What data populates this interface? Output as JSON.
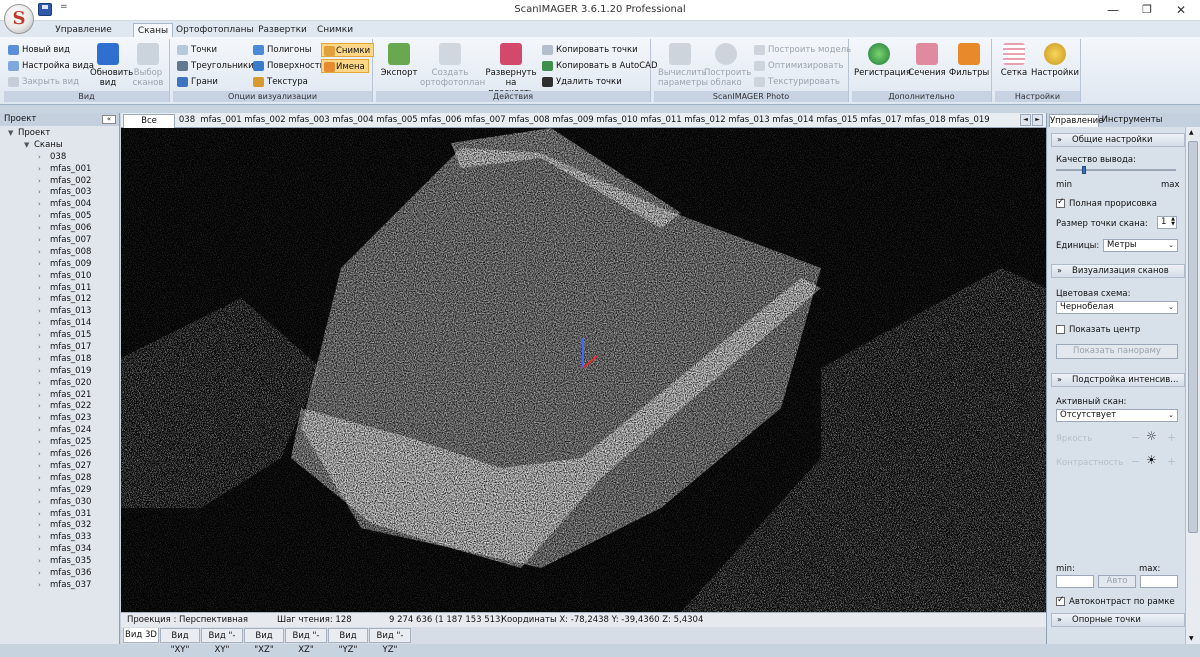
{
  "window": {
    "title": "ScanIMAGER 3.6.1.20 Professional",
    "controls": {
      "minimize": "—",
      "maximize": "❐",
      "close": "✕"
    },
    "logo_letter": "S",
    "qa_dropdown": "="
  },
  "ribbon_tabs": [
    "Управление данными",
    "Сканы",
    "Ортофотопланы",
    "Развертки",
    "Снимки"
  ],
  "ribbon": {
    "view": {
      "label": "Вид",
      "new_view": "Новый вид",
      "view_settings": "Настройка вида",
      "close_view": "Закрыть вид",
      "refresh_view": "Обновить вид",
      "select_scans": "Выбор сканов"
    },
    "vis": {
      "label": "Опции визуализации",
      "points": "Точки",
      "triangles": "Треугольники",
      "edges": "Грани",
      "polygons": "Полигоны",
      "surface": "Поверхность",
      "texture": "Текстура",
      "images": "Снимки",
      "names": "Имена"
    },
    "actions": {
      "label": "Действия",
      "export": "Экспорт",
      "create_ortho": "Создать ортофотоплан",
      "unfold_plane": "Развернуть на плоскость",
      "copy_points": "Копировать точки",
      "copy_autocad": "Копировать в AutoCAD",
      "delete_points": "Удалить точки"
    },
    "photo": {
      "label": "ScanIMAGER Photo",
      "calc_params": "Вычислить параметры",
      "build_cloud": "Построить облако",
      "build_model": "Построить модель",
      "optimize": "Оптимизировать",
      "texture": "Текстурировать"
    },
    "extra": {
      "label": "Дополнительно",
      "registration": "Регистрация",
      "sections": "Сечения",
      "filters": "Фильтры"
    },
    "settings": {
      "label": "Настройки",
      "grid": "Сетка",
      "settings": "Настройки"
    }
  },
  "project_panel": {
    "title": "Проект",
    "pin": "«",
    "root": "Проект",
    "scans_node": "Сканы",
    "items": [
      "038",
      "mfas_001",
      "mfas_002",
      "mfas_003",
      "mfas_004",
      "mfas_005",
      "mfas_006",
      "mfas_007",
      "mfas_008",
      "mfas_009",
      "mfas_010",
      "mfas_011",
      "mfas_012",
      "mfas_013",
      "mfas_014",
      "mfas_015",
      "mfas_017",
      "mfas_018",
      "mfas_019",
      "mfas_020",
      "mfas_021",
      "mfas_022",
      "mfas_023",
      "mfas_024",
      "mfas_025",
      "mfas_026",
      "mfas_027",
      "mfas_028",
      "mfas_029",
      "mfas_030",
      "mfas_031",
      "mfas_032",
      "mfas_033",
      "mfas_034",
      "mfas_035",
      "mfas_036",
      "mfas_037"
    ]
  },
  "scan_tabs": [
    "Все данные",
    "038",
    "mfas_001",
    "mfas_002",
    "mfas_003",
    "mfas_004",
    "mfas_005",
    "mfas_006",
    "mfas_007",
    "mfas_008",
    "mfas_009",
    "mfas_010",
    "mfas_011",
    "mfas_012",
    "mfas_013",
    "mfas_014",
    "mfas_015",
    "mfas_017",
    "mfas_018",
    "mfas_019"
  ],
  "status": {
    "projection": "Проекция : Перспективная",
    "read_step": "Шаг чтения: 128",
    "points": "9 274 636 (1 187 153 513)",
    "coords": "Координаты X: -78,2438  Y: -39,4360  Z: 5,4304"
  },
  "view_tabs": [
    "Вид 3D",
    "Вид \"XY\"",
    "Вид \"-XY\"",
    "Вид \"XZ\"",
    "Вид \"-XZ\"",
    "Вид \"YZ\"",
    "Вид \"-YZ\""
  ],
  "right_panel": {
    "tabs": [
      "Управление",
      "Инструменты"
    ],
    "general": {
      "title": "Общие настройки",
      "quality_label": "Качество вывода:",
      "quality_fraction": 0.22,
      "min": "min",
      "max": "max",
      "full_render": "Полная прорисовка",
      "point_size_label": "Размер точки скана:",
      "point_size": "1",
      "units_label": "Единицы:",
      "units": "Метры"
    },
    "scan_vis": {
      "title": "Визуализация сканов",
      "color_scheme_label": "Цветовая схема:",
      "color_scheme": "Чернобелая",
      "show_center": "Показать центр",
      "show_panorama": "Показать панораму"
    },
    "intensity": {
      "title": "Подстройка интенсив...",
      "active_scan_label": "Активный скан:",
      "active_scan": "Отсутствует",
      "brightness": "Яркость",
      "contrast": "Контрастность",
      "min_label": "min:",
      "max_label": "max:",
      "auto": "Авто",
      "autocontrast": "Автоконтраст по рамке"
    },
    "control_points": {
      "title": "Опорные точки"
    }
  },
  "colors": {
    "accent": "#2e5aa8",
    "ribbon_bg": "#dfe7f1",
    "highlight": "#fbd787"
  }
}
